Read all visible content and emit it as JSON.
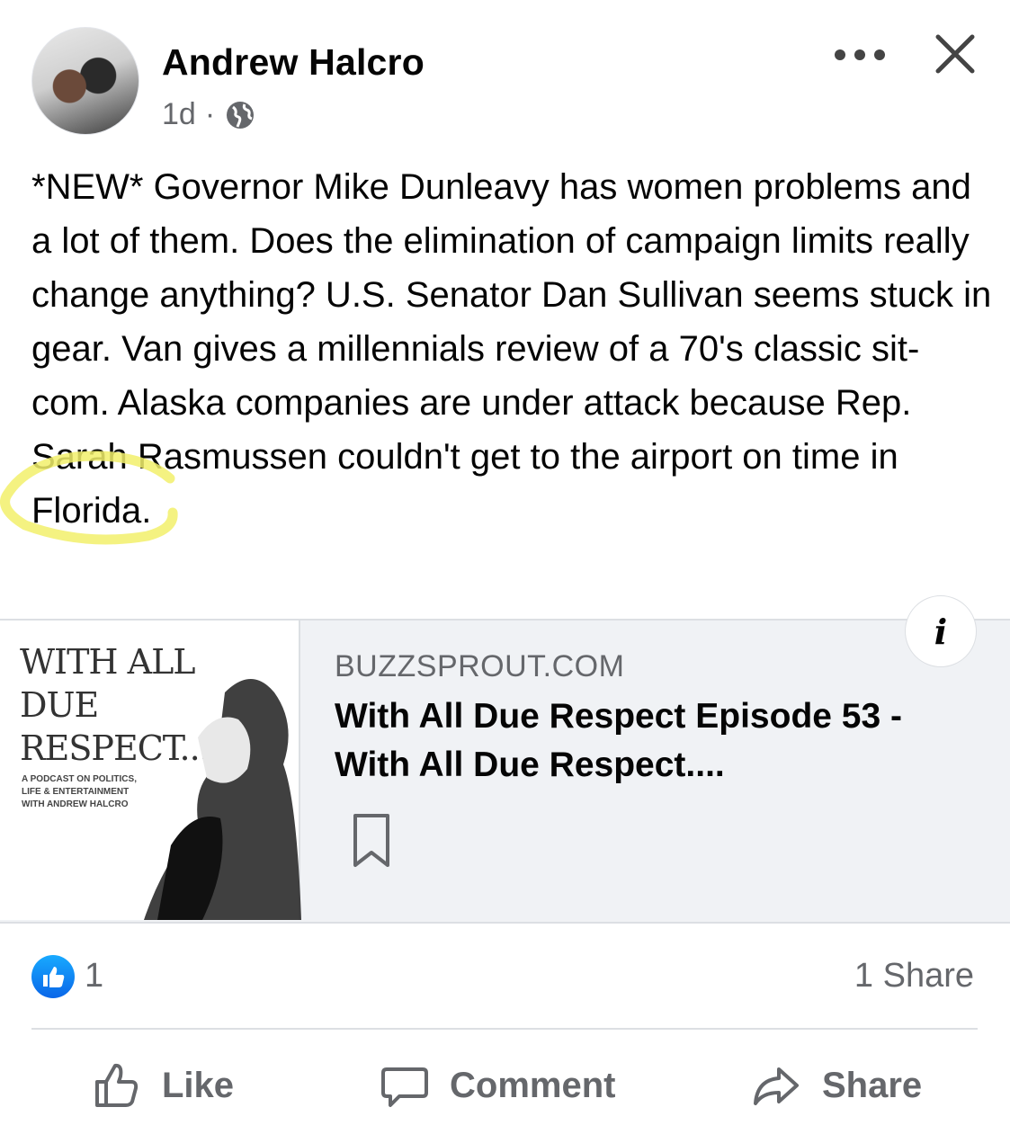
{
  "post": {
    "author": "Andrew Halcro",
    "time": "1d",
    "separator": "·",
    "privacy_icon": "globe-icon",
    "text": "*NEW* Governor Mike Dunleavy has women problems and a lot of them. Does the elimination of campaign limits really change anything? U.S. Senator Dan Sullivan seems stuck in gear. Van gives a millennials review of a 70's classic sit-com. Alaska companies are under attack because Rep. Sarah Rasmussen couldn't get to the airport on time in Florida."
  },
  "link_preview": {
    "thumbnail_title": "WITH ALL DUE RESPECT...",
    "thumbnail_subtitle": "A PODCAST ON POLITICS, LIFE & ENTERTAINMENT WITH ANDREW HALCRO",
    "domain": "BUZZSPROUT.COM",
    "title": "With All Due Respect Episode 53 - With All Due Respect....",
    "info_label": "i"
  },
  "reactions": {
    "like_count": "1",
    "share_count": "1 Share"
  },
  "actions": {
    "like": "Like",
    "comment": "Comment",
    "share": "Share"
  },
  "colors": {
    "like_blue": "#1877f2",
    "muted_text": "#65676b",
    "card_bg": "#f0f2f5",
    "highlight_yellow": "#f4f27a"
  }
}
